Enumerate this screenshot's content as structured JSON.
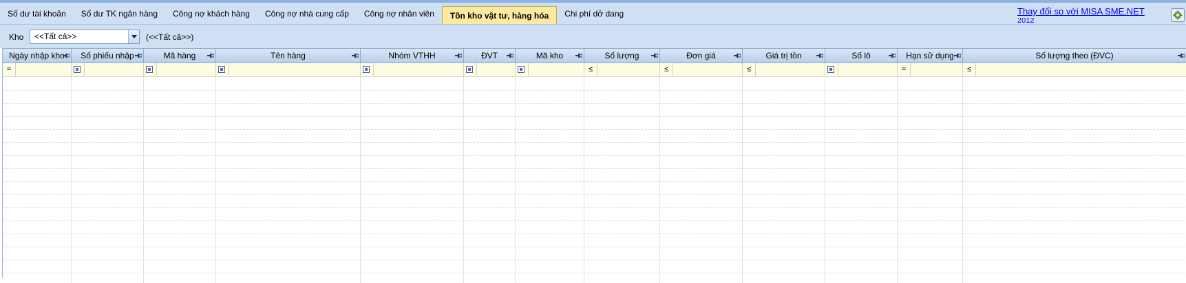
{
  "tabs": [
    {
      "label": "Số dư tài khoản",
      "active": false
    },
    {
      "label": "Số dư TK ngân hàng",
      "active": false
    },
    {
      "label": "Công nợ khách hàng",
      "active": false
    },
    {
      "label": "Công nợ nhà cung cấp",
      "active": false
    },
    {
      "label": "Công nợ nhân viên",
      "active": false
    },
    {
      "label": "Tồn kho vật tư, hàng hóa",
      "active": true
    },
    {
      "label": "Chi phí dở dang",
      "active": false
    }
  ],
  "header_link": {
    "text": "Thay đổi so với MISA SME.NET",
    "overflow_text": "2012"
  },
  "settings_icon": "gear-icon",
  "filter_bar": {
    "kho_label": "Kho",
    "kho_value": "<<Tất cả>>",
    "kho_info": "(<<Tất cả>>)"
  },
  "grid": {
    "columns": [
      {
        "label": "Ngày nhập kho",
        "filter": "="
      },
      {
        "label": "Số phiếu nhập",
        "filter": "box"
      },
      {
        "label": "Mã hàng",
        "filter": "box"
      },
      {
        "label": "Tên hàng",
        "filter": "box"
      },
      {
        "label": "Nhóm VTHH",
        "filter": "box"
      },
      {
        "label": "ĐVT",
        "filter": "box"
      },
      {
        "label": "Mã kho",
        "filter": "box"
      },
      {
        "label": "Số lượng",
        "filter": "≤"
      },
      {
        "label": "Đơn giá",
        "filter": "≤"
      },
      {
        "label": "Giá trị tồn",
        "filter": "≤"
      },
      {
        "label": "Số lô",
        "filter": "box"
      },
      {
        "label": "Hạn sử dụng",
        "filter": "="
      },
      {
        "label": "Số lượng theo (ĐVC)",
        "filter": "≤"
      }
    ],
    "pin_icon": "pin-icon",
    "empty_rows": 15
  },
  "colors": {
    "panel": "#cfe0f5",
    "active_tab": "#fdeaa2",
    "filter_row": "#fffde1",
    "link": "#0000ee"
  }
}
